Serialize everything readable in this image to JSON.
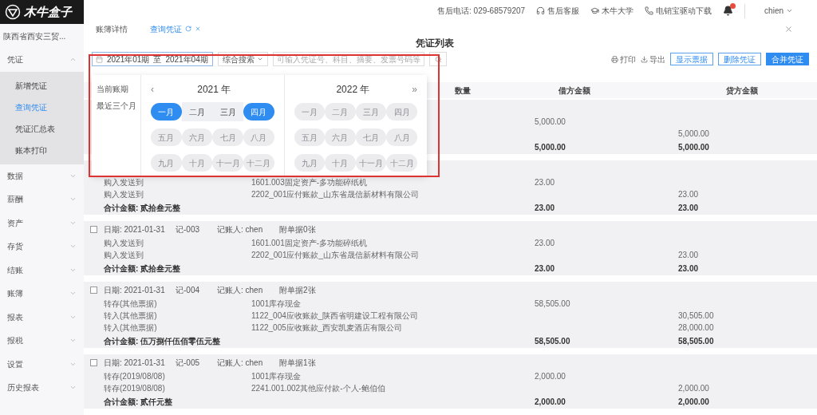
{
  "logo": {
    "text": "木牛盒子"
  },
  "sidebar": {
    "company": "陕西省西安三贸...",
    "menu": [
      {
        "label": "凭证",
        "expanded": true,
        "children": [
          {
            "label": "新增凭证",
            "selected": false
          },
          {
            "label": "查询凭证",
            "selected": true
          },
          {
            "label": "凭证汇总表",
            "selected": false
          },
          {
            "label": "账本打印",
            "selected": false
          }
        ]
      },
      {
        "label": "数据",
        "expanded": false
      },
      {
        "label": "薪酬",
        "expanded": false
      },
      {
        "label": "资产",
        "expanded": false
      },
      {
        "label": "存货",
        "expanded": false
      },
      {
        "label": "结账",
        "expanded": false
      },
      {
        "label": "账簿",
        "expanded": false
      },
      {
        "label": "报表",
        "expanded": false
      },
      {
        "label": "报税",
        "expanded": false
      },
      {
        "label": "设置",
        "expanded": false
      },
      {
        "label": "历史报表",
        "expanded": false
      }
    ]
  },
  "topbar": {
    "hotline": "售后电话: 029-68579207",
    "links": [
      {
        "kind": "headset",
        "label": "售后客服"
      },
      {
        "kind": "cap",
        "label": "木牛大学"
      },
      {
        "kind": "phone",
        "label": "电销宝驱动下载"
      }
    ],
    "bell_badge": true,
    "user": "chien"
  },
  "tabs": [
    {
      "label": "账簿详情",
      "selected": false,
      "closable": false
    },
    {
      "label": "查询凭证",
      "selected": true,
      "closable": true
    }
  ],
  "page_title": "凭证列表",
  "filter": {
    "date_from": "2021年01期",
    "separator": "至",
    "date_to": "2021年04期",
    "search_type": "综合搜索",
    "search_placeholder": "可输入凭证号、科目、摘要、发票号码等"
  },
  "toolbar": {
    "links": [
      {
        "kind": "print",
        "label": "打印"
      },
      {
        "kind": "export",
        "label": "导出"
      }
    ],
    "buttons": [
      {
        "label": "显示票据",
        "primary": false
      },
      {
        "label": "删除凭证",
        "primary": false
      },
      {
        "label": "合并凭证",
        "primary": true
      }
    ]
  },
  "date_picker": {
    "shortcuts": [
      "当前账期",
      "最近三个月"
    ],
    "panels": [
      {
        "year": "2021 年",
        "prev": "‹",
        "months": [
          {
            "label": "一月",
            "selected": true,
            "in_range": false,
            "disabled": false
          },
          {
            "label": "二月",
            "selected": false,
            "in_range": true,
            "disabled": false
          },
          {
            "label": "三月",
            "selected": false,
            "in_range": true,
            "disabled": false
          },
          {
            "label": "四月",
            "selected": true,
            "in_range": false,
            "disabled": false
          },
          {
            "label": "五月",
            "selected": false,
            "in_range": false,
            "disabled": true
          },
          {
            "label": "六月",
            "selected": false,
            "in_range": false,
            "disabled": true
          },
          {
            "label": "七月",
            "selected": false,
            "in_range": false,
            "disabled": true
          },
          {
            "label": "八月",
            "selected": false,
            "in_range": false,
            "disabled": true
          },
          {
            "label": "九月",
            "selected": false,
            "in_range": false,
            "disabled": true
          },
          {
            "label": "十月",
            "selected": false,
            "in_range": false,
            "disabled": true
          },
          {
            "label": "十一月",
            "selected": false,
            "in_range": false,
            "disabled": true
          },
          {
            "label": "十二月",
            "selected": false,
            "in_range": false,
            "disabled": true
          }
        ]
      },
      {
        "year": "2022 年",
        "next": "»",
        "months": [
          {
            "label": "一月",
            "selected": false,
            "in_range": false,
            "disabled": true
          },
          {
            "label": "二月",
            "selected": false,
            "in_range": false,
            "disabled": true
          },
          {
            "label": "三月",
            "selected": false,
            "in_range": false,
            "disabled": true
          },
          {
            "label": "四月",
            "selected": false,
            "in_range": false,
            "disabled": true
          },
          {
            "label": "五月",
            "selected": false,
            "in_range": false,
            "disabled": true
          },
          {
            "label": "六月",
            "selected": false,
            "in_range": false,
            "disabled": true
          },
          {
            "label": "七月",
            "selected": false,
            "in_range": false,
            "disabled": true
          },
          {
            "label": "八月",
            "selected": false,
            "in_range": false,
            "disabled": true
          },
          {
            "label": "九月",
            "selected": false,
            "in_range": false,
            "disabled": true
          },
          {
            "label": "十月",
            "selected": false,
            "in_range": false,
            "disabled": true
          },
          {
            "label": "十一月",
            "selected": false,
            "in_range": false,
            "disabled": true
          },
          {
            "label": "十二月",
            "selected": false,
            "in_range": false,
            "disabled": true
          }
        ]
      }
    ]
  },
  "table": {
    "columns": [
      "数量",
      "借方金额",
      "贷方金额"
    ],
    "vouchers": [
      {
        "entries": [
          {
            "debit": "5,000.00"
          },
          {
            "credit": "5,000.00"
          }
        ],
        "total": {
          "debit": "5,000.00",
          "credit": "5,000.00"
        }
      },
      {
        "entries": [
          {
            "summary": "购入发送到",
            "account": "1601.003固定资产-多功能碎纸机",
            "debit": "23.00"
          },
          {
            "summary": "购入发送到",
            "account": "2202_001应付账款_山东省晟信新材料有限公司",
            "credit": "23.00"
          }
        ],
        "total": {
          "label": "合计金额: 贰拾叁元整",
          "debit": "23.00",
          "credit": "23.00"
        }
      },
      {
        "header": {
          "checked": false,
          "date": "日期: 2021-01-31",
          "number": "记-003",
          "recorder": "记账人: chen",
          "attachments": "附单据0张"
        },
        "entries": [
          {
            "summary": "购入发送到",
            "account": "1601.001固定资产-多功能碎纸机",
            "debit": "23.00"
          },
          {
            "summary": "购入发送到",
            "account": "2202_001应付账款_山东省晟信新材料有限公司",
            "credit": "23.00"
          }
        ],
        "total": {
          "label": "合计金额: 贰拾叁元整",
          "debit": "23.00",
          "credit": "23.00"
        }
      },
      {
        "header": {
          "checked": false,
          "date": "日期: 2021-01-31",
          "number": "记-004",
          "recorder": "记账人: chen",
          "attachments": "附单据2张"
        },
        "entries": [
          {
            "summary": "转存(其他票据)",
            "account": "1001库存现金",
            "debit": "58,505.00"
          },
          {
            "summary": "转入(其他票据)",
            "account": "1122_004应收账款_陕西省明建设工程有限公司",
            "credit": "30,505.00"
          },
          {
            "summary": "转入(其他票据)",
            "account": "1122_005应收账款_西安凯麦酒店有限公司",
            "credit": "28,000.00"
          }
        ],
        "total": {
          "label": "合计金额: 伍万捌仟伍佰零伍元整",
          "debit": "58,505.00",
          "credit": "58,505.00"
        }
      },
      {
        "header": {
          "checked": false,
          "date": "日期: 2021-01-31",
          "number": "记-005",
          "recorder": "记账人: chen",
          "attachments": "附单据1张"
        },
        "entries": [
          {
            "summary": "转存(2019/08/08)",
            "account": "1001库存现金",
            "debit": "2,000.00"
          },
          {
            "summary": "转存(2019/08/08)",
            "account": "2241.001.002其他应付款-个人-鲍伯伯",
            "credit": "2,000.00"
          }
        ],
        "total": {
          "label": "合计金额: 贰仟元整",
          "debit": "2,000.00",
          "credit": "2,000.00"
        }
      }
    ]
  }
}
